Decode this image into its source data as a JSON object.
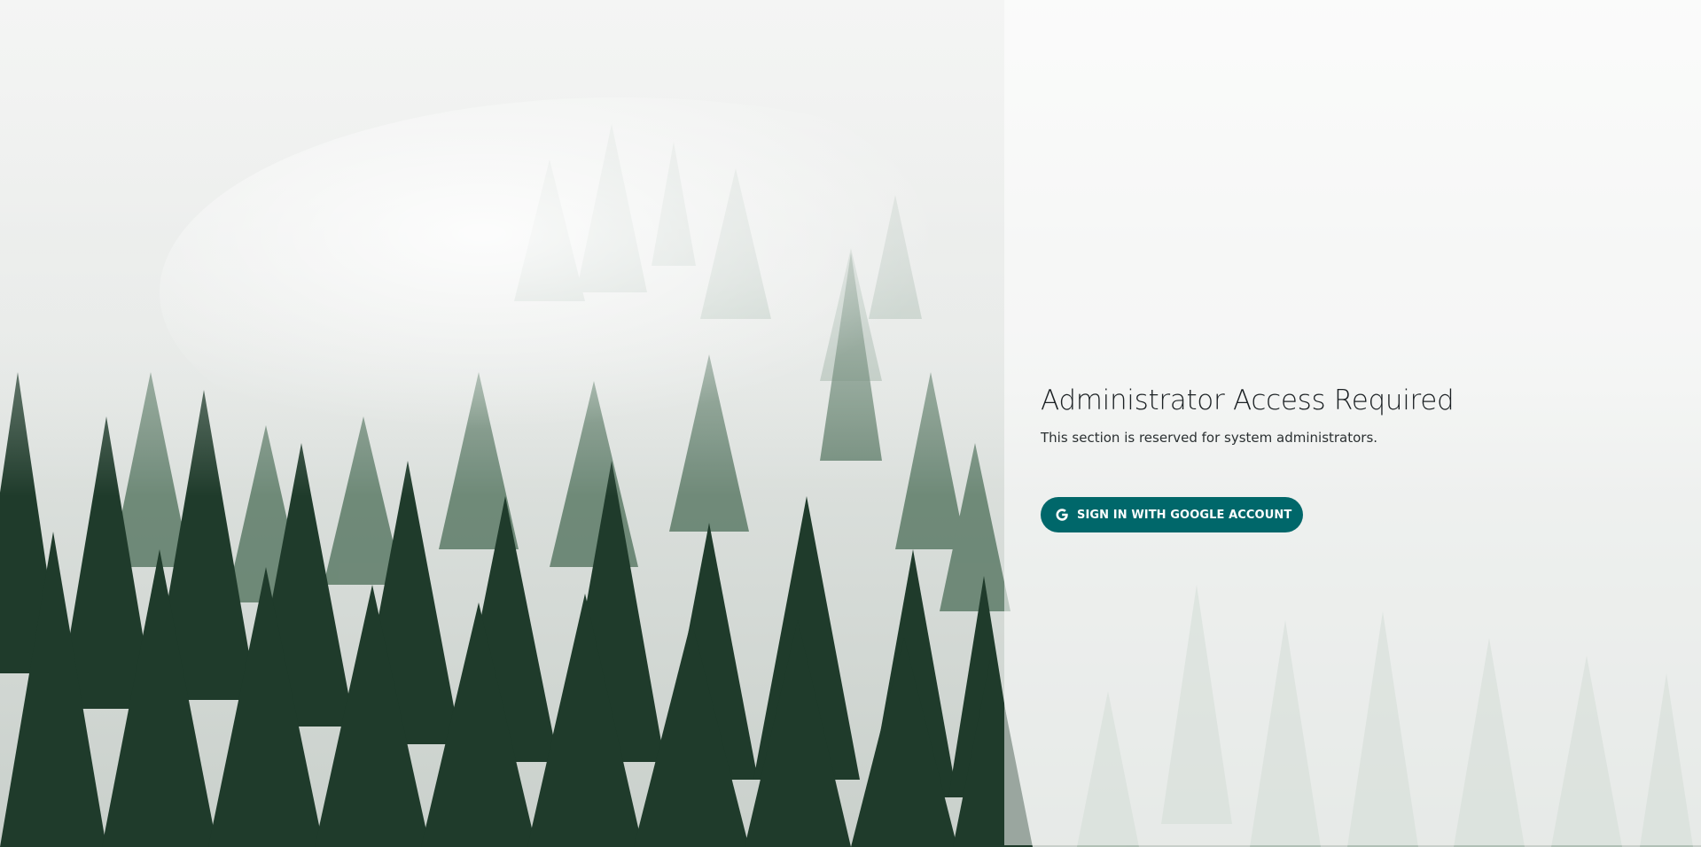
{
  "login": {
    "title": "Administrator Access Required",
    "subtitle": "This section is reserved for system administrators.",
    "signin_label": "SIGN IN WITH GOOGLE ACCOUNT",
    "signin_icon": "google-icon"
  },
  "colors": {
    "accent": "#00676a",
    "text": "#1c2124"
  }
}
